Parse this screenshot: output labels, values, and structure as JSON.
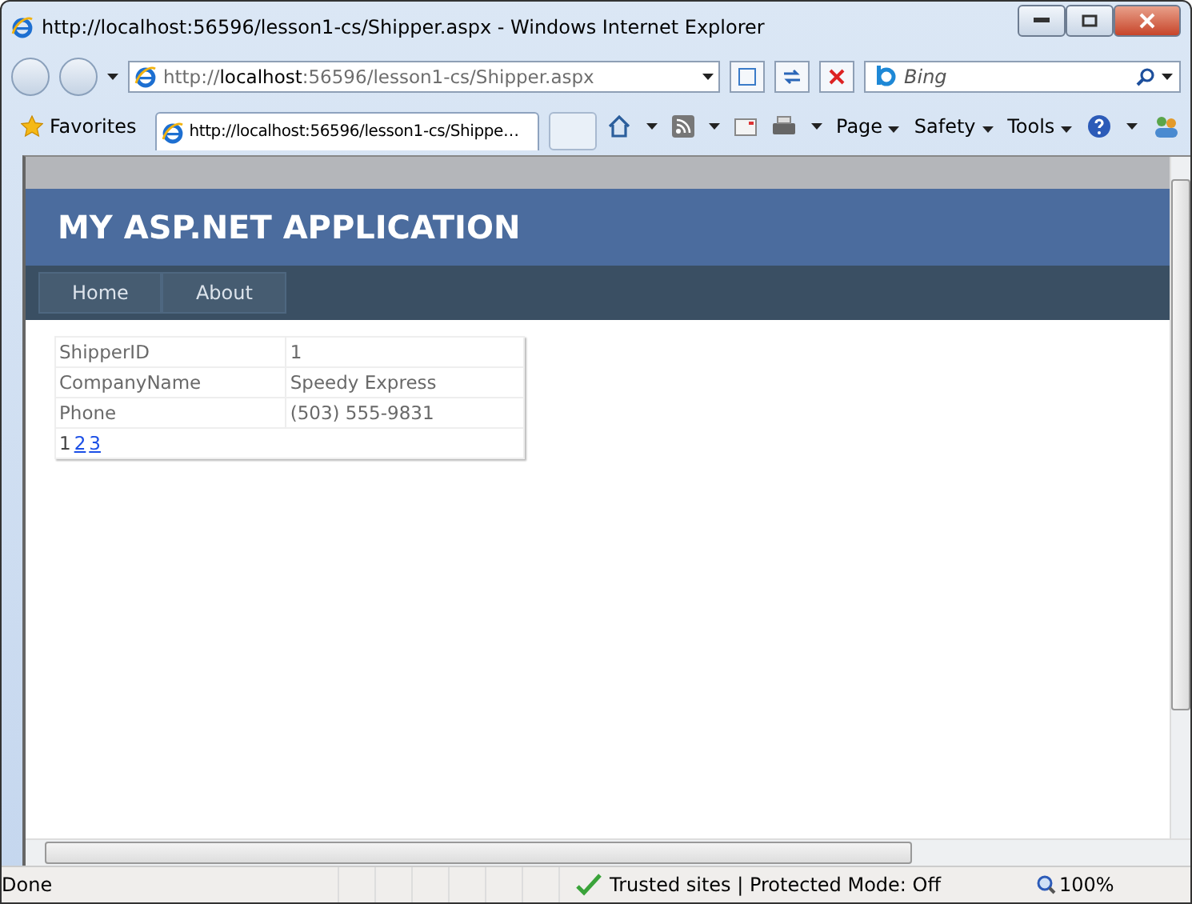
{
  "window": {
    "title": "http://localhost:56596/lesson1-cs/Shipper.aspx - Windows Internet Explorer"
  },
  "address_bar": {
    "url": "http://**localhost**:56596/lesson1-cs/Shipper.aspx"
  },
  "search": {
    "placeholder": "Bing"
  },
  "favorites": {
    "label": "Favorites"
  },
  "tabs": [
    {
      "label": "http://localhost:56596/lesson1-cs/Shippe…",
      "selected": true
    }
  ],
  "command_bar": [
    "Page",
    "Safety",
    "Tools"
  ],
  "site": {
    "title": "MY ASP.NET APPLICATION",
    "menu": [
      "Home",
      "About"
    ]
  },
  "details": {
    "rows": [
      {
        "field": "ShipperID",
        "value": "1"
      },
      {
        "field": "CompanyName",
        "value": "Speedy Express"
      },
      {
        "field": "Phone",
        "value": "(503) 555-9831"
      }
    ],
    "pager": [
      {
        "label": "1",
        "selected": true
      },
      {
        "label": "2",
        "selected": false
      },
      {
        "label": "3",
        "selected": false
      }
    ]
  },
  "status_bar": {
    "text": "Done",
    "zone": "Trusted sites | Protected Mode: Off",
    "zoom": "100%"
  }
}
